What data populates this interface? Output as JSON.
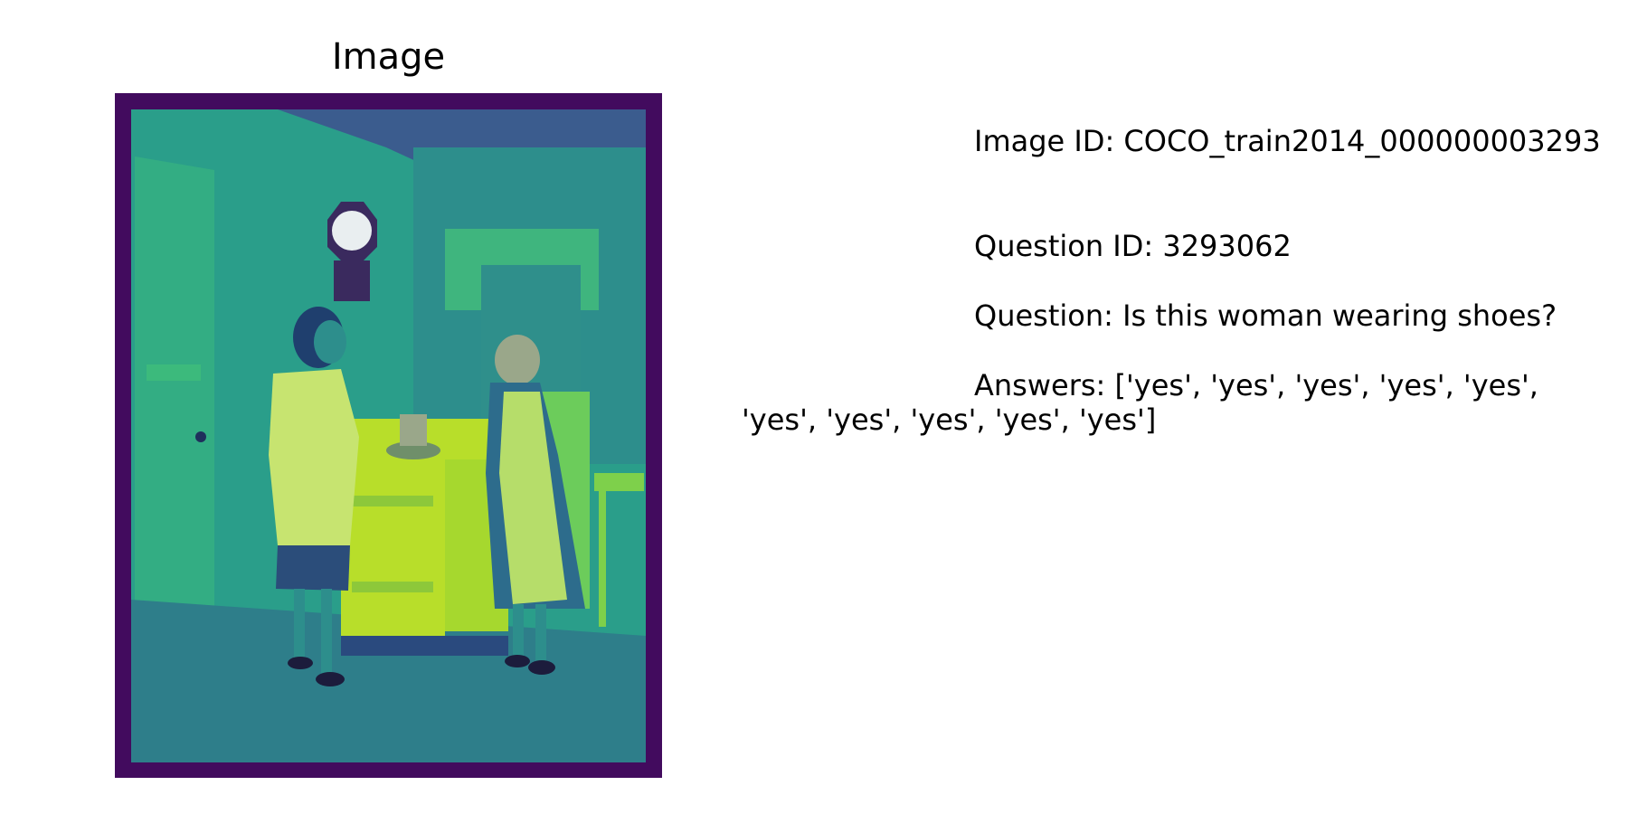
{
  "figure": {
    "image_panel": {
      "title": "Image",
      "icon": "photo-icon",
      "subject": "kitchen-scene"
    },
    "info_panel": {
      "image_id_line": "Image ID: COCO_train2014_000000003293",
      "question_id_line": "Question ID: 3293062",
      "question_line": "Question: Is this woman wearing shoes?",
      "answers_line_1": "Answers: ['yes', 'yes', 'yes', 'yes', 'yes',",
      "answers_line_2": "'yes', 'yes', 'yes', 'yes', 'yes']"
    },
    "colors": {
      "frame": "#420b5e",
      "wall": "#2a9e8a",
      "ceiling": "#3b5c8e",
      "floor": "#2e7e8a",
      "stove": "#b8de2a",
      "apron": "#c7e470"
    }
  }
}
